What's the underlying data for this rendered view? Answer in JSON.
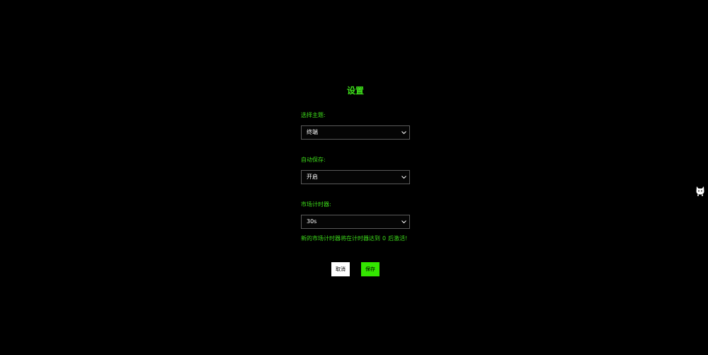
{
  "settings": {
    "title": "设置",
    "theme": {
      "label": "选择主题:",
      "selected": "终端"
    },
    "autosave": {
      "label": "自动保存:",
      "selected": "开启"
    },
    "market_timer": {
      "label": "市场计时器:",
      "selected": "30s",
      "hint_prefix": "新的市场计时器将在计时器达到",
      "hint_number": "0",
      "hint_suffix": "后激活!"
    },
    "buttons": {
      "cancel": "取消",
      "save": "保存"
    }
  },
  "icons": {
    "select_arrow": "chevron-down-icon",
    "side_widget": "cat-mascot-icon"
  },
  "colors": {
    "background": "#000000",
    "accent": "#3ddc1a",
    "save_button": "#33e600",
    "cancel_button": "#ffffff"
  }
}
